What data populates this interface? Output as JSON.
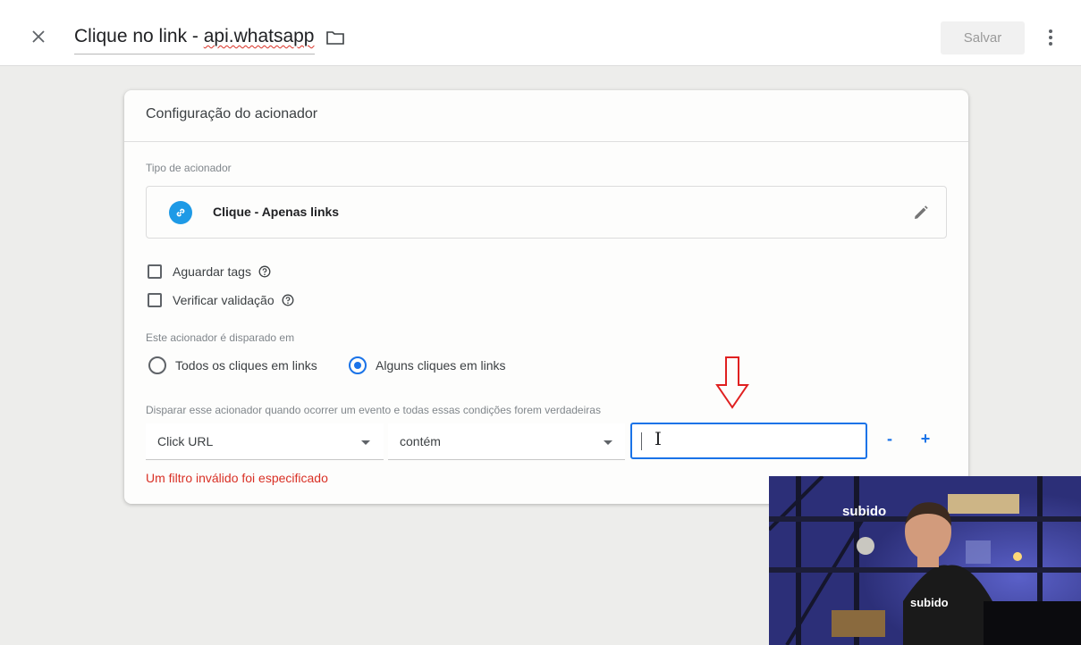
{
  "header": {
    "title_prefix": "Clique no link - ",
    "title_suffix": "api.whatsapp",
    "save_label": "Salvar"
  },
  "card": {
    "title": "Configuração do acionador",
    "trigger_type_label": "Tipo de acionador",
    "trigger_type_name": "Clique - Apenas links",
    "checkboxes": [
      {
        "label": "Aguardar tags",
        "checked": false
      },
      {
        "label": "Verificar validação",
        "checked": false
      }
    ],
    "fires_on_label": "Este acionador é disparado em",
    "radio_all": "Todos os cliques em links",
    "radio_some": "Alguns cliques em links",
    "selected_radio": "Alguns cliques em links",
    "condition_label": "Disparar esse acionador quando ocorrer um evento e todas essas condições forem verdadeiras",
    "condition": {
      "variable": "Click URL",
      "operator": "contém",
      "value": ""
    },
    "minus_label": "-",
    "plus_label": "+",
    "error": "Um filtro inválido foi especificado"
  },
  "webcam": {
    "sign_text": "subido",
    "shirt_text": "subido"
  },
  "colors": {
    "accent": "#1a73e8",
    "error": "#d93025",
    "link_icon": "#1e9ae6",
    "annotation_arrow": "#e02020"
  }
}
